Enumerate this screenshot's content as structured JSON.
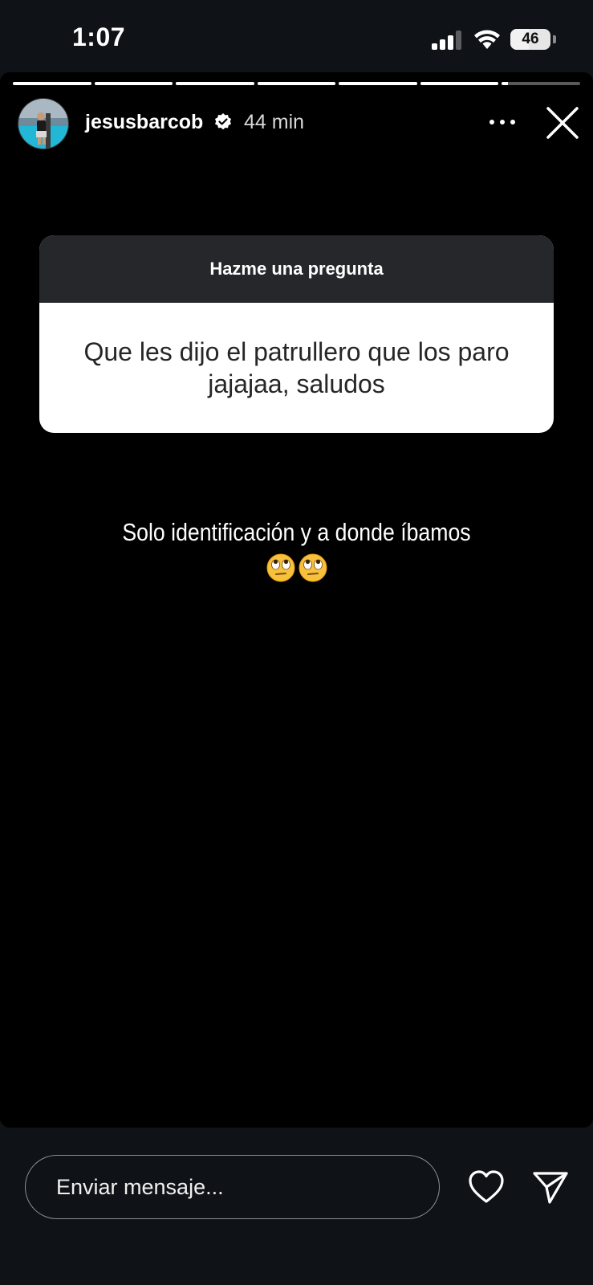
{
  "status_bar": {
    "time": "1:07",
    "battery_level": "46",
    "battery_fraction": 0.46
  },
  "story": {
    "progress": {
      "segments": 7,
      "completed": 6,
      "current_fraction": 0.08
    },
    "header": {
      "username": "jesusbarcob",
      "verified": true,
      "time_ago": "44 min",
      "more_icon": "more-dots-icon",
      "close_icon": "close-icon"
    },
    "question_sticker": {
      "title": "Hazme una pregunta",
      "question": "Que les dijo el patrullero que los paro jajajaa, saludos"
    },
    "answer": {
      "text": "Solo identificación y a donde íbamos",
      "emoji": "🙄🙄"
    }
  },
  "reply_bar": {
    "placeholder": "Enviar mensaje...",
    "like_icon": "heart-icon",
    "share_icon": "send-icon"
  },
  "colors": {
    "background": "#000000",
    "sticker_header": "#26272b",
    "sticker_body": "#ffffff",
    "sticker_text": "#262626",
    "status_bg": "#0f1217"
  }
}
